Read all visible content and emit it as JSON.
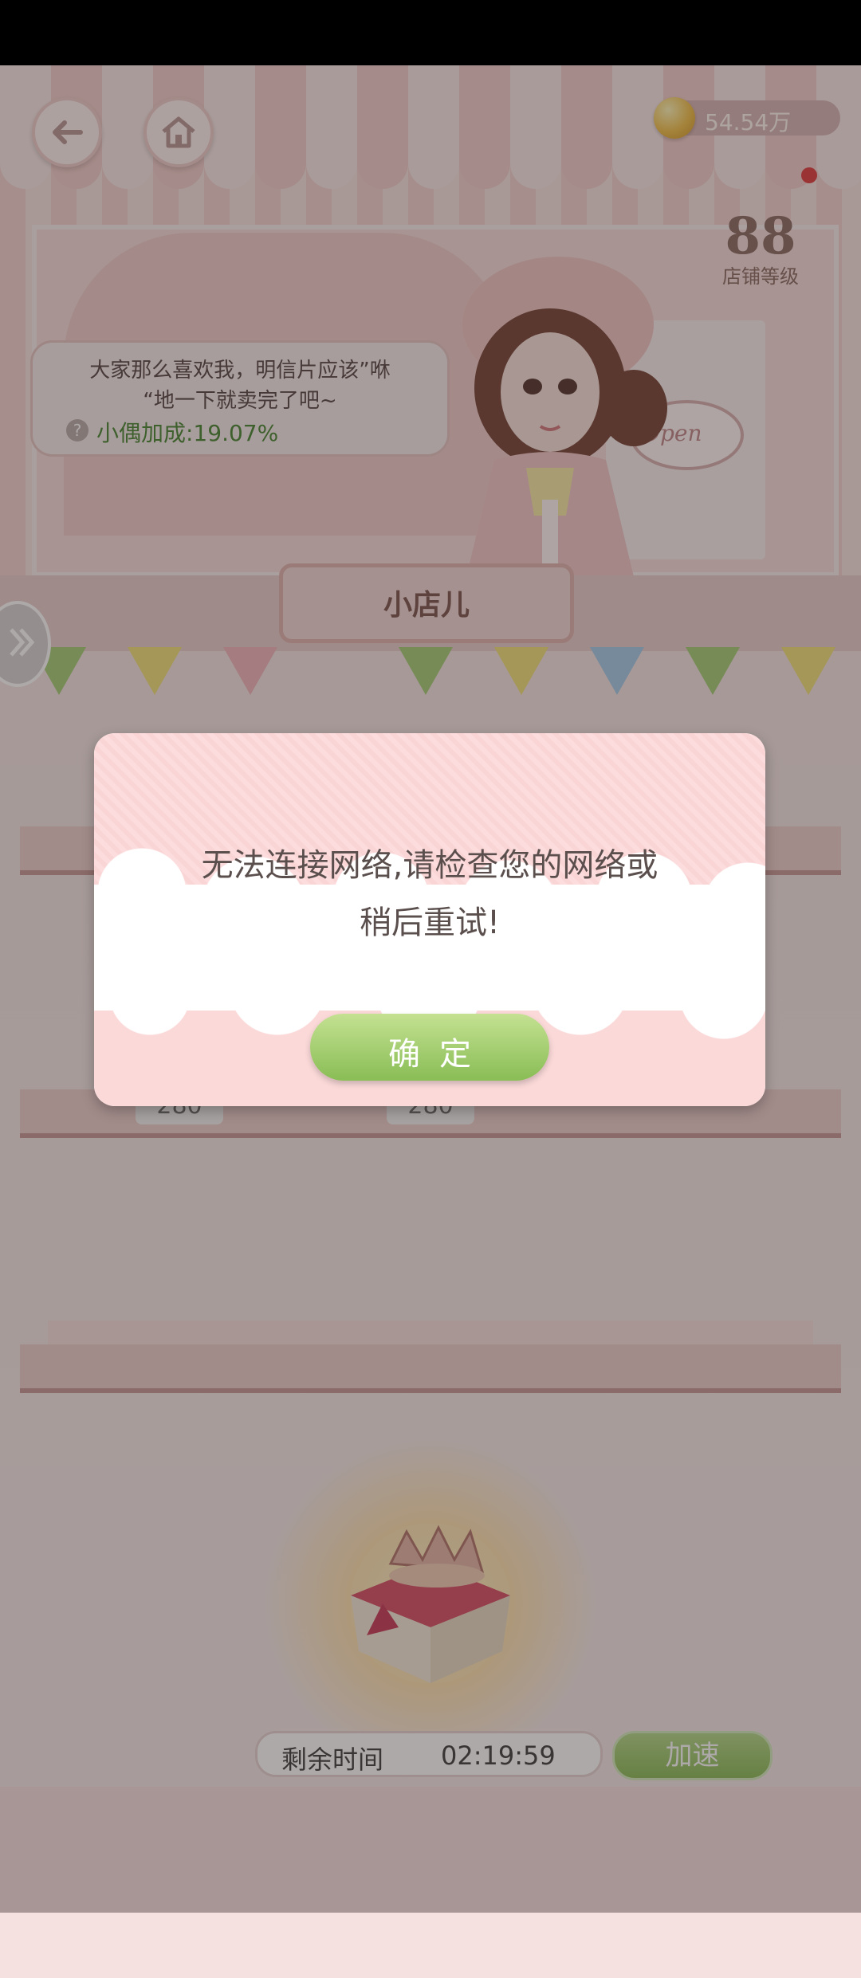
{
  "header": {
    "coins": "54.54万",
    "shop_level_number": "88",
    "shop_level_label": "店铺等级"
  },
  "speech_bubble": {
    "line1": "大家那么喜欢我，明信片应该”咻",
    "line2": "“地一下就卖完了吧~",
    "bonus": "小偶加成:19.07%"
  },
  "shop": {
    "title": "小店儿",
    "sign": "Open"
  },
  "shelves": {
    "price_1": "280",
    "price_2": "280"
  },
  "production": {
    "remaining_label": "剩余时间",
    "remaining_time": "02:19:59",
    "speedup_label": "加速"
  },
  "dialog": {
    "message_line1": "无法连接网络,请检查您的网络或",
    "message_line2": "稍后重试!",
    "confirm_label": "确定"
  },
  "colors": {
    "confirm_button": "#9cc86a",
    "red_dot": "#e14243",
    "bonus_text": "#4d8a37"
  }
}
